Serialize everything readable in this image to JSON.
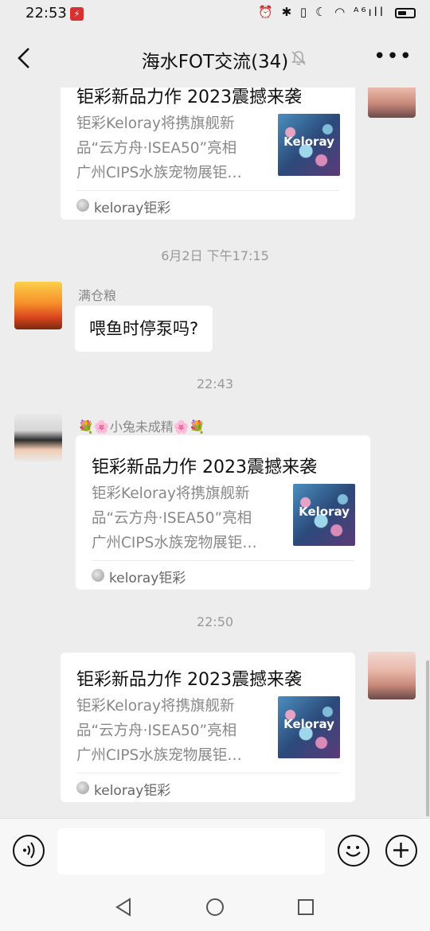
{
  "status_bar": {
    "time": "22:53",
    "icons": "⏰ ✱ ▯ ☾ ◠ ᴬ⁶ıll",
    "battery_level": 0.55
  },
  "header": {
    "title": "海水FOT交流(34)",
    "more": "•••"
  },
  "messages": [
    {
      "type": "link-card",
      "side": "right",
      "card": {
        "title": "钜彩新品力作 2023震撼来袭",
        "desc": [
          "钜彩Keloray将携旗舰新",
          "品“云方舟·ISEA50”亮相",
          "广州CIPS水族宠物展钜…"
        ],
        "thumb_text": "Keloray",
        "source": "keloray钜彩"
      }
    },
    {
      "type": "time",
      "text": "6月2日 下午17:15"
    },
    {
      "type": "text",
      "side": "left",
      "sender": "满仓粮",
      "text": "喂鱼时停泵吗?"
    },
    {
      "type": "time",
      "text": "22:43"
    },
    {
      "type": "link-card",
      "side": "left",
      "sender": "💐🌸小兔未成精🌸💐",
      "card": {
        "title": "钜彩新品力作 2023震撼来袭",
        "desc": [
          "钜彩Keloray将携旗舰新",
          "品“云方舟·ISEA50”亮相",
          "广州CIPS水族宠物展钜…"
        ],
        "thumb_text": "Keloray",
        "source": "keloray钜彩"
      }
    },
    {
      "type": "time",
      "text": "22:50"
    },
    {
      "type": "link-card",
      "side": "right",
      "card": {
        "title": "钜彩新品力作 2023震撼来袭",
        "desc": [
          "钜彩Keloray将携旗舰新",
          "品“云方舟·ISEA50”亮相",
          "广州CIPS水族宠物展钜…"
        ],
        "thumb_text": "Keloray",
        "source": "keloray钜彩"
      }
    }
  ],
  "colors": {
    "background": "#ededed",
    "bubble": "#ffffff",
    "meta_text": "#888888"
  }
}
